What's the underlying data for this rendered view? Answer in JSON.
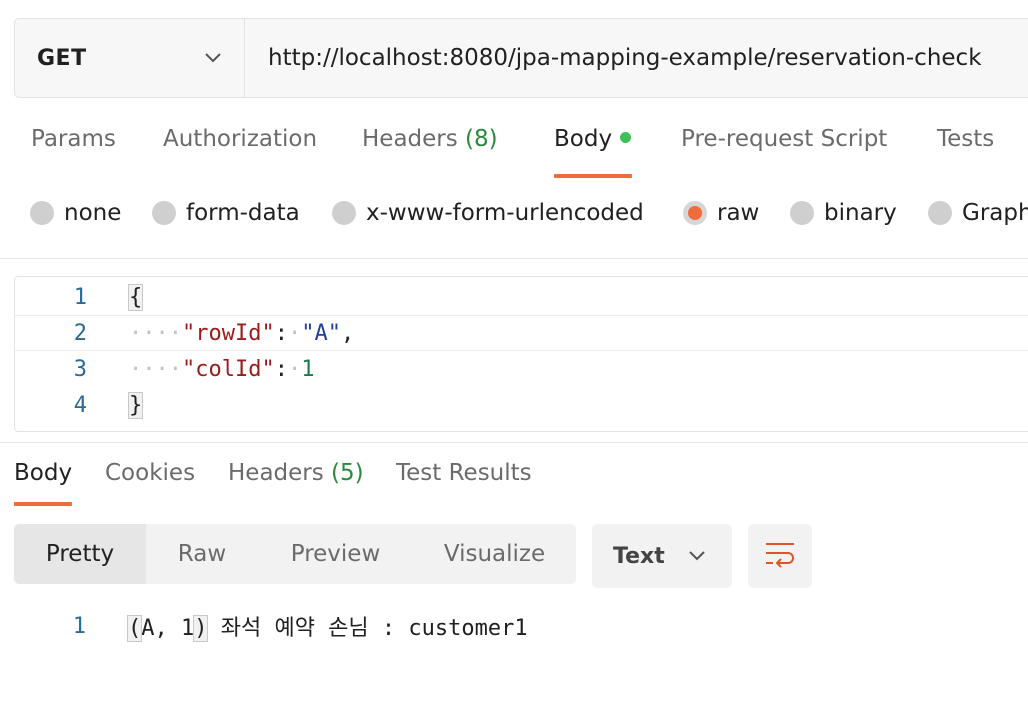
{
  "request": {
    "method": "GET",
    "url": "http://localhost:8080/jpa-mapping-example/reservation-check"
  },
  "request_tabs": [
    {
      "label": "Params"
    },
    {
      "label": "Authorization"
    },
    {
      "label": "Headers",
      "count": "(8)"
    },
    {
      "label": "Body",
      "active": true,
      "indicator_color": "#3fbf55"
    },
    {
      "label": "Pre-request Script"
    },
    {
      "label": "Tests"
    }
  ],
  "body_types": [
    {
      "label": "none"
    },
    {
      "label": "form-data"
    },
    {
      "label": "x-www-form-urlencoded"
    },
    {
      "label": "raw",
      "selected": true
    },
    {
      "label": "binary"
    },
    {
      "label": "Graph"
    }
  ],
  "editor": {
    "lines": [
      {
        "number": "1",
        "text": "{"
      },
      {
        "number": "2",
        "key": "\"rowId\"",
        "value": "\"A\"",
        "trail": ","
      },
      {
        "number": "3",
        "key": "\"colId\"",
        "value": "1",
        "trail": ""
      },
      {
        "number": "4",
        "text": "}"
      }
    ]
  },
  "response_tabs": [
    {
      "label": "Body",
      "active": true
    },
    {
      "label": "Cookies"
    },
    {
      "label": "Headers",
      "count": "(5)"
    },
    {
      "label": "Test Results"
    }
  ],
  "view_modes": [
    {
      "label": "Pretty",
      "active": true
    },
    {
      "label": "Raw"
    },
    {
      "label": "Preview"
    },
    {
      "label": "Visualize"
    }
  ],
  "format": {
    "selected": "Text"
  },
  "response": {
    "line_number": "1",
    "paren_open": "(",
    "paren_content": "A, 1",
    "paren_close": ")",
    "text": " 좌석 예약 손님 : customer1"
  },
  "colors": {
    "accent": "#f26b3a",
    "count_green": "#2a8a3e"
  }
}
